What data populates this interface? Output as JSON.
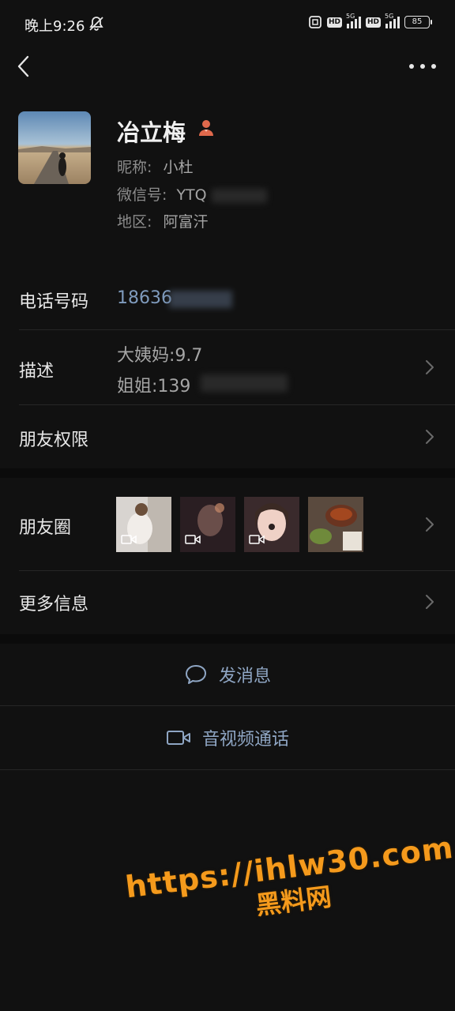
{
  "status": {
    "time": "晚上9:26",
    "network1": "5G",
    "network2": "5G",
    "hd": "HD",
    "battery": "85"
  },
  "profile": {
    "name": "冶立梅",
    "nickname_label": "昵称:",
    "nickname": "小杜",
    "wechat_label": "微信号:",
    "wechat_id": "YTQ",
    "region_label": "地区:",
    "region": "阿富汗"
  },
  "phone": {
    "label": "电话号码",
    "value": "18636"
  },
  "description": {
    "label": "描述",
    "line1": "大姨妈:9.7",
    "line2": "姐姐:139"
  },
  "permissions": {
    "label": "朋友权限"
  },
  "moments": {
    "label": "朋友圈"
  },
  "more": {
    "label": "更多信息"
  },
  "actions": {
    "message": "发消息",
    "call": "音视频通话"
  },
  "watermark": {
    "url": "https://ihlw30.com",
    "text": "黑料网"
  },
  "colors": {
    "background": "#111111",
    "accent_link": "#8fa6c4",
    "phone_text": "#7f9bbd",
    "watermark": "#f59a1c"
  }
}
